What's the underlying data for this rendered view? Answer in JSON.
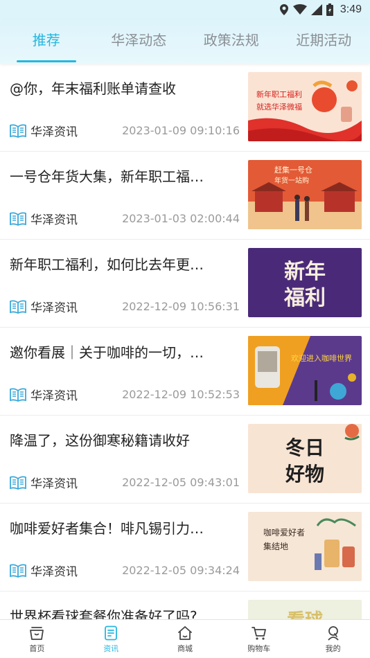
{
  "status_bar": {
    "time": "3:49"
  },
  "tabs": [
    {
      "label": "推荐",
      "active": true
    },
    {
      "label": "华泽动态",
      "active": false
    },
    {
      "label": "政策法规",
      "active": false
    },
    {
      "label": "近期活动",
      "active": false
    }
  ],
  "articles": [
    {
      "title": "@你，年末福利账单请查收",
      "source": "华泽资讯",
      "date": "2023-01-09 09:10:16",
      "thumb_text": [
        "新年职工福利",
        "就选华泽微福"
      ]
    },
    {
      "title": "一号仓年货大集，新年职工福…",
      "source": "华泽资讯",
      "date": "2023-01-03 02:00:44",
      "thumb_text": [
        "赶集一号仓",
        "年货一站购"
      ]
    },
    {
      "title": "新年职工福利，如何比去年更…",
      "source": "华泽资讯",
      "date": "2022-12-09 10:56:31",
      "thumb_text": [
        "新年",
        "福利"
      ]
    },
    {
      "title": "邀你看展｜关于咖啡的一切，…",
      "source": "华泽资讯",
      "date": "2022-12-09 10:52:53",
      "thumb_text": [
        "欢迎进入咖啡世界"
      ]
    },
    {
      "title": "降温了，这份御寒秘籍请收好",
      "source": "华泽资讯",
      "date": "2022-12-05 09:43:01",
      "thumb_text": [
        "冬日",
        "好物"
      ]
    },
    {
      "title": "咖啡爱好者集合！啡凡锡引力…",
      "source": "华泽资讯",
      "date": "2022-12-05 09:34:24",
      "thumb_text": [
        "咖啡爱好者",
        "集结地"
      ]
    },
    {
      "title": "世界杯看球套餐你准备好了吗?",
      "source": "",
      "date": "",
      "thumb_text": [
        "看球"
      ]
    }
  ],
  "bottom_nav": [
    {
      "label": "首页",
      "icon": "home-basket-icon",
      "active": false
    },
    {
      "label": "资讯",
      "icon": "news-icon",
      "active": true
    },
    {
      "label": "商城",
      "icon": "shop-icon",
      "active": false
    },
    {
      "label": "购物车",
      "icon": "cart-icon",
      "active": false
    },
    {
      "label": "我的",
      "icon": "profile-icon",
      "active": false
    }
  ],
  "colors": {
    "accent": "#26b6df",
    "header_bg": "#ddf4fb"
  }
}
